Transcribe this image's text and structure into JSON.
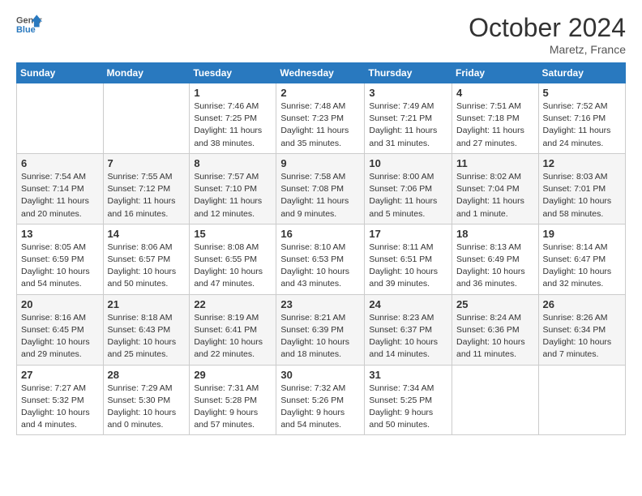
{
  "header": {
    "logo_line1": "General",
    "logo_line2": "Blue",
    "month": "October 2024",
    "location": "Maretz, France"
  },
  "weekdays": [
    "Sunday",
    "Monday",
    "Tuesday",
    "Wednesday",
    "Thursday",
    "Friday",
    "Saturday"
  ],
  "weeks": [
    [
      {
        "day": "",
        "info": ""
      },
      {
        "day": "",
        "info": ""
      },
      {
        "day": "1",
        "info": "Sunrise: 7:46 AM\nSunset: 7:25 PM\nDaylight: 11 hours and 38 minutes."
      },
      {
        "day": "2",
        "info": "Sunrise: 7:48 AM\nSunset: 7:23 PM\nDaylight: 11 hours and 35 minutes."
      },
      {
        "day": "3",
        "info": "Sunrise: 7:49 AM\nSunset: 7:21 PM\nDaylight: 11 hours and 31 minutes."
      },
      {
        "day": "4",
        "info": "Sunrise: 7:51 AM\nSunset: 7:18 PM\nDaylight: 11 hours and 27 minutes."
      },
      {
        "day": "5",
        "info": "Sunrise: 7:52 AM\nSunset: 7:16 PM\nDaylight: 11 hours and 24 minutes."
      }
    ],
    [
      {
        "day": "6",
        "info": "Sunrise: 7:54 AM\nSunset: 7:14 PM\nDaylight: 11 hours and 20 minutes."
      },
      {
        "day": "7",
        "info": "Sunrise: 7:55 AM\nSunset: 7:12 PM\nDaylight: 11 hours and 16 minutes."
      },
      {
        "day": "8",
        "info": "Sunrise: 7:57 AM\nSunset: 7:10 PM\nDaylight: 11 hours and 12 minutes."
      },
      {
        "day": "9",
        "info": "Sunrise: 7:58 AM\nSunset: 7:08 PM\nDaylight: 11 hours and 9 minutes."
      },
      {
        "day": "10",
        "info": "Sunrise: 8:00 AM\nSunset: 7:06 PM\nDaylight: 11 hours and 5 minutes."
      },
      {
        "day": "11",
        "info": "Sunrise: 8:02 AM\nSunset: 7:04 PM\nDaylight: 11 hours and 1 minute."
      },
      {
        "day": "12",
        "info": "Sunrise: 8:03 AM\nSunset: 7:01 PM\nDaylight: 10 hours and 58 minutes."
      }
    ],
    [
      {
        "day": "13",
        "info": "Sunrise: 8:05 AM\nSunset: 6:59 PM\nDaylight: 10 hours and 54 minutes."
      },
      {
        "day": "14",
        "info": "Sunrise: 8:06 AM\nSunset: 6:57 PM\nDaylight: 10 hours and 50 minutes."
      },
      {
        "day": "15",
        "info": "Sunrise: 8:08 AM\nSunset: 6:55 PM\nDaylight: 10 hours and 47 minutes."
      },
      {
        "day": "16",
        "info": "Sunrise: 8:10 AM\nSunset: 6:53 PM\nDaylight: 10 hours and 43 minutes."
      },
      {
        "day": "17",
        "info": "Sunrise: 8:11 AM\nSunset: 6:51 PM\nDaylight: 10 hours and 39 minutes."
      },
      {
        "day": "18",
        "info": "Sunrise: 8:13 AM\nSunset: 6:49 PM\nDaylight: 10 hours and 36 minutes."
      },
      {
        "day": "19",
        "info": "Sunrise: 8:14 AM\nSunset: 6:47 PM\nDaylight: 10 hours and 32 minutes."
      }
    ],
    [
      {
        "day": "20",
        "info": "Sunrise: 8:16 AM\nSunset: 6:45 PM\nDaylight: 10 hours and 29 minutes."
      },
      {
        "day": "21",
        "info": "Sunrise: 8:18 AM\nSunset: 6:43 PM\nDaylight: 10 hours and 25 minutes."
      },
      {
        "day": "22",
        "info": "Sunrise: 8:19 AM\nSunset: 6:41 PM\nDaylight: 10 hours and 22 minutes."
      },
      {
        "day": "23",
        "info": "Sunrise: 8:21 AM\nSunset: 6:39 PM\nDaylight: 10 hours and 18 minutes."
      },
      {
        "day": "24",
        "info": "Sunrise: 8:23 AM\nSunset: 6:37 PM\nDaylight: 10 hours and 14 minutes."
      },
      {
        "day": "25",
        "info": "Sunrise: 8:24 AM\nSunset: 6:36 PM\nDaylight: 10 hours and 11 minutes."
      },
      {
        "day": "26",
        "info": "Sunrise: 8:26 AM\nSunset: 6:34 PM\nDaylight: 10 hours and 7 minutes."
      }
    ],
    [
      {
        "day": "27",
        "info": "Sunrise: 7:27 AM\nSunset: 5:32 PM\nDaylight: 10 hours and 4 minutes."
      },
      {
        "day": "28",
        "info": "Sunrise: 7:29 AM\nSunset: 5:30 PM\nDaylight: 10 hours and 0 minutes."
      },
      {
        "day": "29",
        "info": "Sunrise: 7:31 AM\nSunset: 5:28 PM\nDaylight: 9 hours and 57 minutes."
      },
      {
        "day": "30",
        "info": "Sunrise: 7:32 AM\nSunset: 5:26 PM\nDaylight: 9 hours and 54 minutes."
      },
      {
        "day": "31",
        "info": "Sunrise: 7:34 AM\nSunset: 5:25 PM\nDaylight: 9 hours and 50 minutes."
      },
      {
        "day": "",
        "info": ""
      },
      {
        "day": "",
        "info": ""
      }
    ]
  ]
}
